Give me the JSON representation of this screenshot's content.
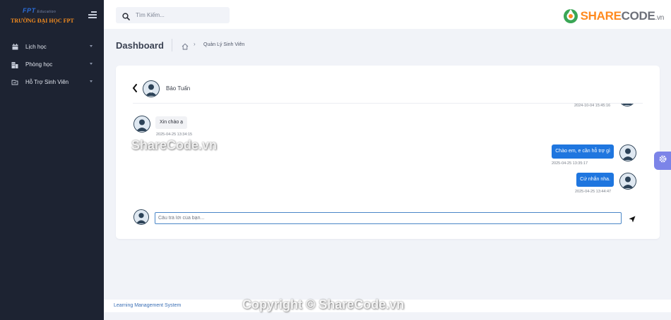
{
  "brand": {
    "logo_text": "FPT",
    "logo_sub": "Education",
    "name": "TRƯỜNG ĐẠI HỌC FPT"
  },
  "sidebar": {
    "items": [
      {
        "label": "Lịch học",
        "icon": "calendar-icon"
      },
      {
        "label": "Phòng học",
        "icon": "building-icon"
      },
      {
        "label": "Hỗ Trợ Sinh Viên",
        "icon": "support-icon"
      }
    ]
  },
  "search": {
    "placeholder": "Tìm Kiếm...",
    "value": ""
  },
  "site_logo": {
    "part1": "SHARE",
    "part2": "CODE",
    "part3": ".vn"
  },
  "page": {
    "title": "Dashboard",
    "breadcrumb": "Quản Lý Sinh Viên"
  },
  "chat": {
    "contact_name": "Bảo Tuấn",
    "messages": [
      {
        "direction": "out",
        "text": "",
        "time": "2024-10-04 15:45:16"
      },
      {
        "direction": "in",
        "text": "Xin chào ạ",
        "time": "2025-04-25 13:34:15"
      },
      {
        "direction": "out",
        "text": "Chào em, e cần hỗ trợ gì",
        "time": "2025-04-25 13:35:17"
      },
      {
        "direction": "out",
        "text": "Cứ nhắn nha.",
        "time": "2025-04-25 13:44:47"
      }
    ],
    "reply_placeholder": "Câu trả lời của bạn...",
    "reply_value": ""
  },
  "watermark": "ShareCode.vn",
  "footer": {
    "link": "Learning Management System",
    "copyright": "Copyright © ShareCode.vn"
  },
  "colors": {
    "sidebar_bg": "#1d2332",
    "accent": "#1f76df",
    "settings_tab": "#7c84e8",
    "brand_orange": "#f38b1e"
  }
}
